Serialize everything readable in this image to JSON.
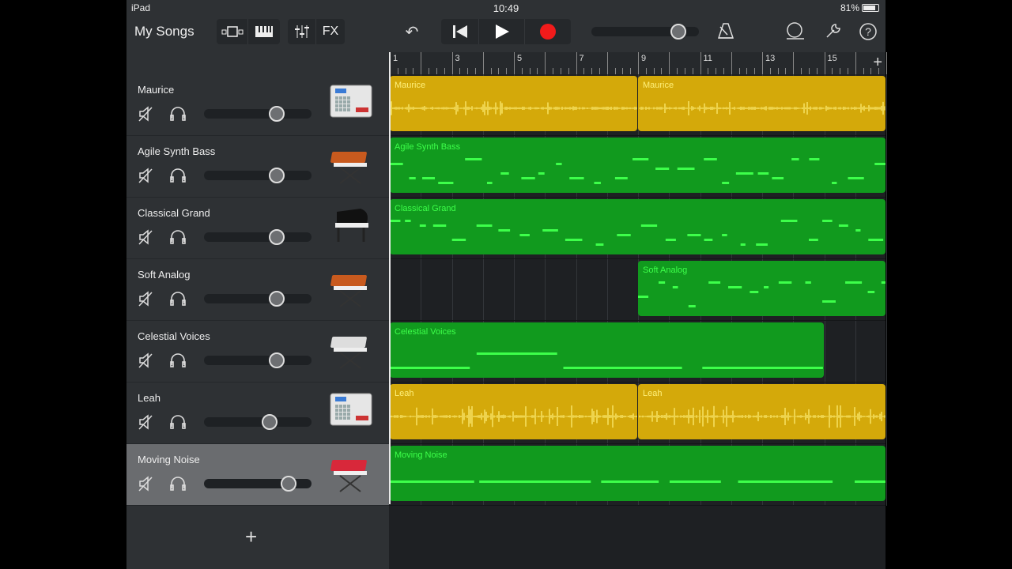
{
  "status": {
    "device": "iPad",
    "time": "10:49",
    "battery": "81%",
    "battery_level": 0.81
  },
  "toolbar": {
    "my_songs": "My Songs",
    "tracks_view_icon": "tracks-view-icon",
    "keyboard_icon": "piano-keys-icon",
    "mixer_icon": "mixer-sliders-icon",
    "fx": "FX",
    "undo_icon": "undo-icon",
    "rewind_icon": "go-to-beginning-icon",
    "play_icon": "play-icon",
    "record_icon": "record-icon",
    "master_volume": 0.81,
    "metronome_icon": "metronome-icon",
    "loop_icon": "loop-browser-icon",
    "settings_icon": "wrench-icon",
    "help_icon": "help-icon"
  },
  "ruler": {
    "labels": [
      "1",
      "3",
      "5",
      "7",
      "9",
      "11",
      "13",
      "15"
    ],
    "add": "+"
  },
  "colors": {
    "audio_region": "#d4a90a",
    "audio_text": "#fff07a",
    "midi_region": "#119a1e",
    "midi_note": "#3dff4a",
    "selected_header": "#6a6c6f"
  },
  "tracks": [
    {
      "name": "Maurice",
      "volume": 0.68,
      "type": "audio",
      "instrument": "drum-machine",
      "regions": [
        {
          "label": "Maurice",
          "start": 1,
          "end": 9
        },
        {
          "label": "Maurice",
          "start": 9,
          "end": 17
        }
      ]
    },
    {
      "name": "Agile Synth Bass",
      "volume": 0.68,
      "type": "midi",
      "instrument": "synth",
      "regions": [
        {
          "label": "Agile Synth Bass",
          "start": 1,
          "end": 17
        }
      ]
    },
    {
      "name": "Classical Grand",
      "volume": 0.68,
      "type": "midi",
      "instrument": "piano",
      "regions": [
        {
          "label": "Classical Grand",
          "start": 1,
          "end": 17
        }
      ]
    },
    {
      "name": "Soft Analog",
      "volume": 0.68,
      "type": "midi",
      "instrument": "synth",
      "regions": [
        {
          "label": "Soft Analog",
          "start": 9,
          "end": 17
        }
      ]
    },
    {
      "name": "Celestial Voices",
      "volume": 0.68,
      "type": "midi",
      "instrument": "keyboard",
      "regions": [
        {
          "label": "Celestial Voices",
          "start": 1,
          "end": 15
        }
      ]
    },
    {
      "name": "Leah",
      "volume": 0.61,
      "type": "audio",
      "instrument": "drum-machine",
      "regions": [
        {
          "label": "Leah",
          "start": 1,
          "end": 9
        },
        {
          "label": "Leah",
          "start": 9,
          "end": 17
        }
      ]
    },
    {
      "name": "Moving Noise",
      "volume": 0.79,
      "type": "midi",
      "instrument": "red-keyboard",
      "selected": true,
      "regions": [
        {
          "label": "Moving Noise",
          "start": 1,
          "end": 17
        }
      ]
    }
  ],
  "add_track": "+"
}
